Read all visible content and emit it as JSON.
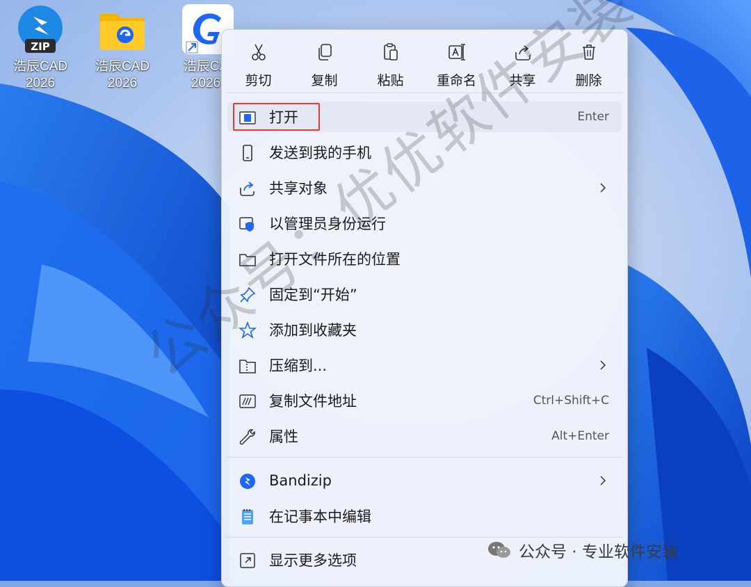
{
  "desktop": {
    "icons": [
      {
        "label_line1": "浩辰CAD",
        "label_line2": "2026",
        "icon": "zip-archive-icon",
        "badge": "ZIP"
      },
      {
        "label_line1": "浩辰CAD",
        "label_line2": "2026",
        "icon": "folder-icon"
      },
      {
        "label_line1": "浩辰CA",
        "label_line2": "2026",
        "icon": "gstarcad-shortcut-icon"
      }
    ]
  },
  "context_menu": {
    "toolbar": [
      {
        "label": "剪切",
        "icon": "scissors-icon"
      },
      {
        "label": "复制",
        "icon": "copy-icon"
      },
      {
        "label": "粘贴",
        "icon": "paste-icon"
      },
      {
        "label": "重命名",
        "icon": "rename-icon"
      },
      {
        "label": "共享",
        "icon": "share-icon"
      },
      {
        "label": "删除",
        "icon": "trash-icon"
      }
    ],
    "items": [
      {
        "label": "打开",
        "shortcut": "Enter",
        "icon": "open-app-icon",
        "highlighted": true
      },
      {
        "label": "发送到我的手机",
        "icon": "phone-icon"
      },
      {
        "label": "共享对象",
        "icon": "share-icon",
        "submenu": true
      },
      {
        "label": "以管理员身份运行",
        "icon": "admin-shield-icon"
      },
      {
        "label": "打开文件所在的位置",
        "icon": "folder-open-icon"
      },
      {
        "label": "固定到“开始”",
        "icon": "pin-icon"
      },
      {
        "label": "添加到收藏夹",
        "icon": "star-icon"
      },
      {
        "label": "压缩到...",
        "icon": "zip-folder-icon",
        "submenu": true
      },
      {
        "label": "复制文件地址",
        "shortcut": "Ctrl+Shift+C",
        "icon": "copy-path-icon"
      },
      {
        "label": "属性",
        "shortcut": "Alt+Enter",
        "icon": "wrench-icon"
      },
      {
        "label": "Bandizip",
        "icon": "bandizip-icon",
        "submenu": true
      },
      {
        "label": "在记事本中编辑",
        "icon": "notepad-icon"
      },
      {
        "label": "显示更多选项",
        "icon": "more-options-icon"
      }
    ]
  },
  "watermark": "公众号：优优软件安装",
  "footer_watermark": "公众号 · 专业软件安装",
  "colors": {
    "highlight_border": "#e53935",
    "accent": "#1a73e8"
  }
}
